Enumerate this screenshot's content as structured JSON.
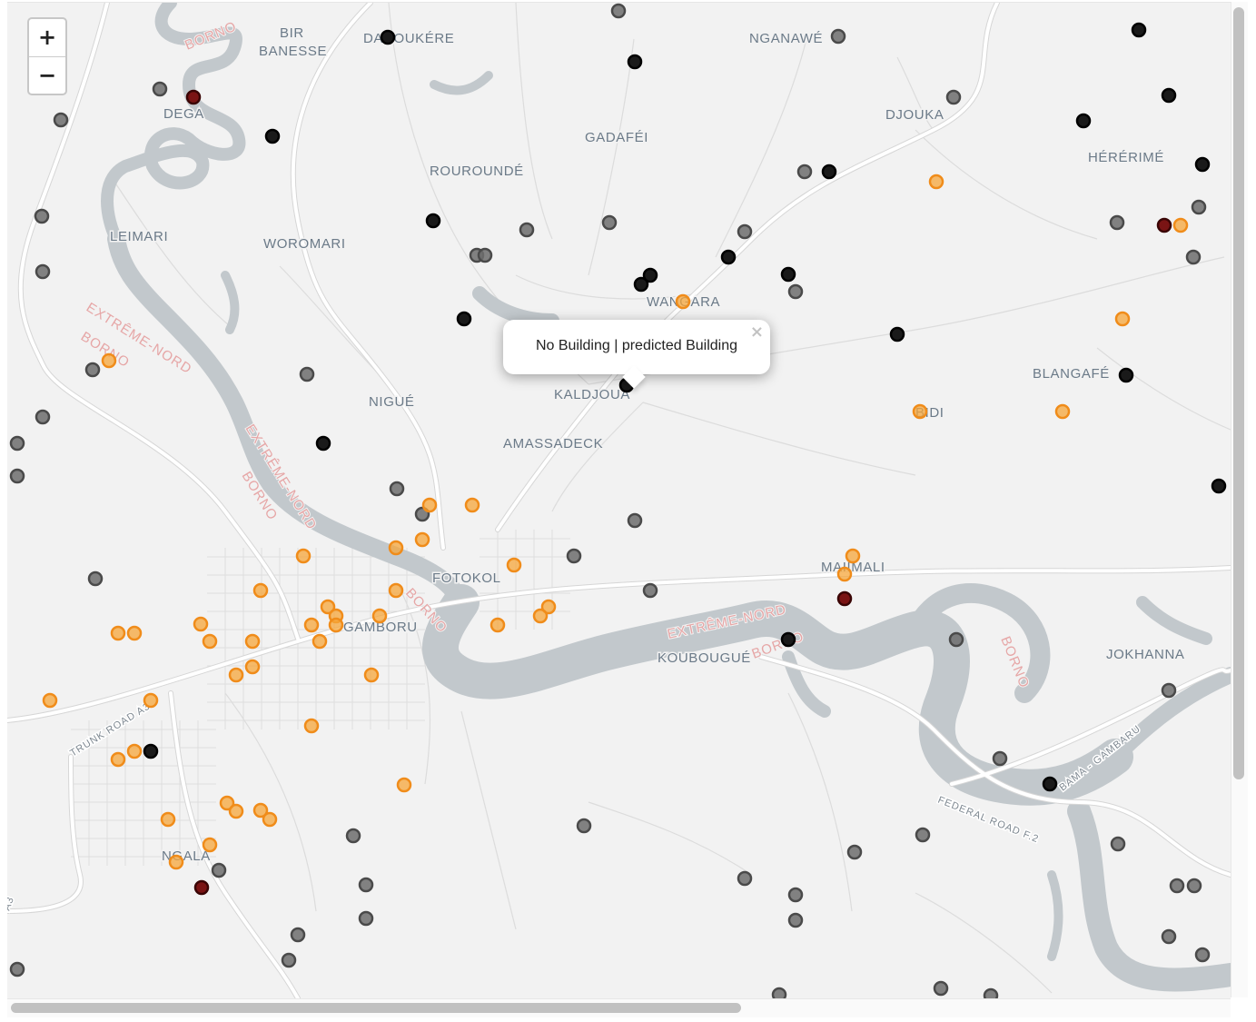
{
  "zoom": {
    "in_label": "+",
    "out_label": "−"
  },
  "popup": {
    "text": "No Building | predicted Building",
    "close_label": "×"
  },
  "colors": {
    "land": "#f2f2f2",
    "water": "#c2c8cc",
    "road": "#ffffff",
    "road_casing": "#d6d6d6",
    "place_label": "#6b7a88",
    "region_label": "#e6a6a6",
    "marker_black": "#1a1a1a",
    "marker_gray": "#6d6d6d",
    "marker_orange": "#f5a53a",
    "marker_darkred": "#7a1414"
  },
  "place_labels": [
    "BIR",
    "BANESSE",
    "DAROUKÉRE",
    "NGANAWÉ",
    "DEGA",
    "DJOUKA",
    "GADAFÉI",
    "ROUROUNDÉ",
    "HÉRÉRIMÉ",
    "LEIMARI",
    "WOROMARI",
    "WANGARA",
    "BLANGAFÉ",
    "NIGUÉ",
    "KALDJOUA",
    "BIDI",
    "AMASSADECK",
    "FOTOKOL",
    "MAIIMALI",
    "GAMBORU",
    "KOUBOUGUÉ",
    "JOKHANNA",
    "NGALA"
  ],
  "region_labels": [
    "BORNO",
    "EXTRÊME-NORD",
    "BORNO",
    "EXTRÊME-NORD",
    "BORNO",
    "BORNO",
    "EXTRÊME-NORD",
    "BORNO",
    "BORNO"
  ],
  "road_labels": [
    "TRUNK ROAD A3",
    "FEDERAL ROAD F.2",
    "BAMA - GAMBARU",
    "A3"
  ],
  "markers": {
    "black": 30,
    "gray": 63,
    "orange": 55,
    "darkred": 5
  }
}
